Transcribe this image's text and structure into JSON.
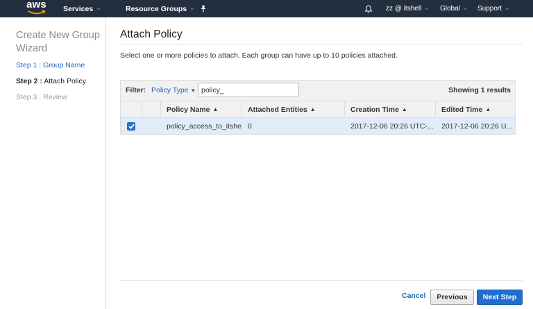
{
  "nav": {
    "logo": "aws",
    "services": "Services",
    "resource_groups": "Resource Groups",
    "account": "zz @ itshell",
    "region": "Global",
    "support": "Support"
  },
  "sidebar": {
    "title": "Create New Group Wizard",
    "steps": [
      {
        "label": "Step 1 : Group Name",
        "state": "link"
      },
      {
        "prefix": "Step 2 :",
        "label": "Attach Policy",
        "state": "current"
      },
      {
        "label": "Step 3 : Review",
        "state": "disabled"
      }
    ]
  },
  "main": {
    "title": "Attach Policy",
    "description": "Select one or more policies to attach. Each group can have up to 10 policies attached.",
    "filter": {
      "label": "Filter:",
      "policy_type": "Policy Type",
      "value": "policy_",
      "results": "Showing 1 results"
    },
    "columns": [
      "Policy Name",
      "Attached Entities",
      "Creation Time",
      "Edited Time"
    ],
    "rows": [
      {
        "checked": true,
        "policy_name": "policy_access_to_itshe...",
        "attached_entities": "0",
        "creation_time": "2017-12-06 20:26 UTC-...",
        "edited_time": "2017-12-06 20:26 U..."
      }
    ],
    "buttons": {
      "cancel": "Cancel",
      "previous": "Previous",
      "next": "Next Step"
    }
  },
  "colors": {
    "nav_bg": "#232f3e",
    "link": "#1f65b9",
    "selected_row": "#e1ecfa",
    "primary_button": "#1f6fd0"
  }
}
